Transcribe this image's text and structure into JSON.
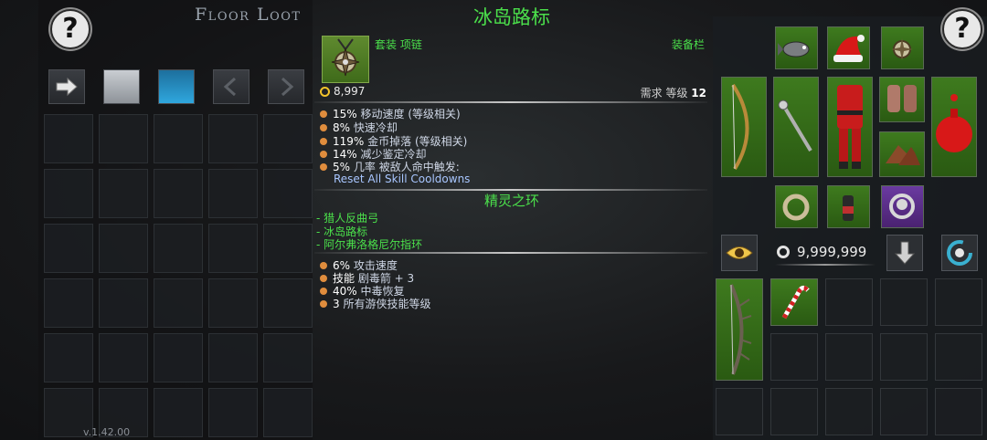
{
  "floor_loot": {
    "title": "Floor Loot",
    "version": "v.1.42.00",
    "help_label": "?"
  },
  "tooltip": {
    "item_name": "冰岛路标",
    "item_type": "套装 项链",
    "equip_label": "装备栏",
    "gold": "8,997",
    "req_level_label": "需求 等级",
    "req_level": "12",
    "stats": [
      {
        "value": "15%",
        "text": "移动速度 (等级相关)"
      },
      {
        "value": "8%",
        "text": "快速冷却"
      },
      {
        "value": "119%",
        "text": "金币掉落 (等级相关)"
      },
      {
        "value": "14%",
        "text": "减少鉴定冷却"
      },
      {
        "value": "5%",
        "text": "几率 被敌人命中触发:"
      }
    ],
    "trigger_skill": "Reset All Skill Cooldowns",
    "set_name": "精灵之环",
    "set_items": [
      "- 猎人反曲弓",
      "- 冰岛路标",
      "- 阿尔弗洛格尼尔指环"
    ],
    "set_bonuses": [
      {
        "value": "6%",
        "text": "攻击速度"
      },
      {
        "value": "技能",
        "text": "剧毒箭 + 3"
      },
      {
        "value": "40%",
        "text": "中毒恢复"
      },
      {
        "value": "3",
        "text": "所有游侠技能等级"
      }
    ]
  },
  "inventory": {
    "help_label": "?",
    "gold_total": "9,999,999"
  },
  "colors": {
    "set_green": "#4be04b",
    "stat_dot": "#e08d3d",
    "skill_blue": "#a8c6ff",
    "slot_green": "#3e7a1e"
  },
  "icons": {
    "arrow": "arrow-right-icon",
    "eye": "eye-icon",
    "down": "arrow-down-icon",
    "refresh": "refresh-icon"
  }
}
